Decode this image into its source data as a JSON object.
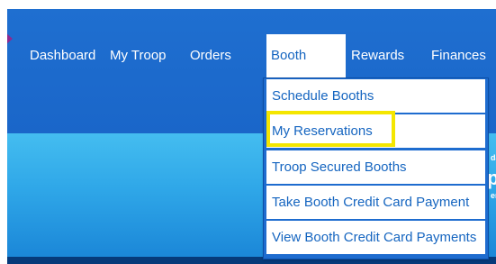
{
  "nav": {
    "items": [
      {
        "label": "Dashboard"
      },
      {
        "label": "My Troop"
      },
      {
        "label": "Orders"
      },
      {
        "label": "Booth"
      },
      {
        "label": "Rewards"
      },
      {
        "label": "Finances"
      }
    ],
    "active": "Booth"
  },
  "booth_menu": {
    "items": [
      {
        "label": "Schedule Booths"
      },
      {
        "label": "My Reservations"
      },
      {
        "label": "Troop Secured Booths"
      },
      {
        "label": "Take Booth Credit Card Payment"
      },
      {
        "label": "View Booth Credit Card Payments"
      }
    ],
    "highlighted": "My Reservations"
  },
  "hero": {
    "fragments": [
      "dat",
      "p",
      "ent"
    ]
  },
  "colors": {
    "nav_blue": "#1f6fd0",
    "hero_blue": "#2fa7e8",
    "link_blue": "#1565c0",
    "highlight_yellow": "#f4e600",
    "marker_purple": "#8e2a8f"
  }
}
